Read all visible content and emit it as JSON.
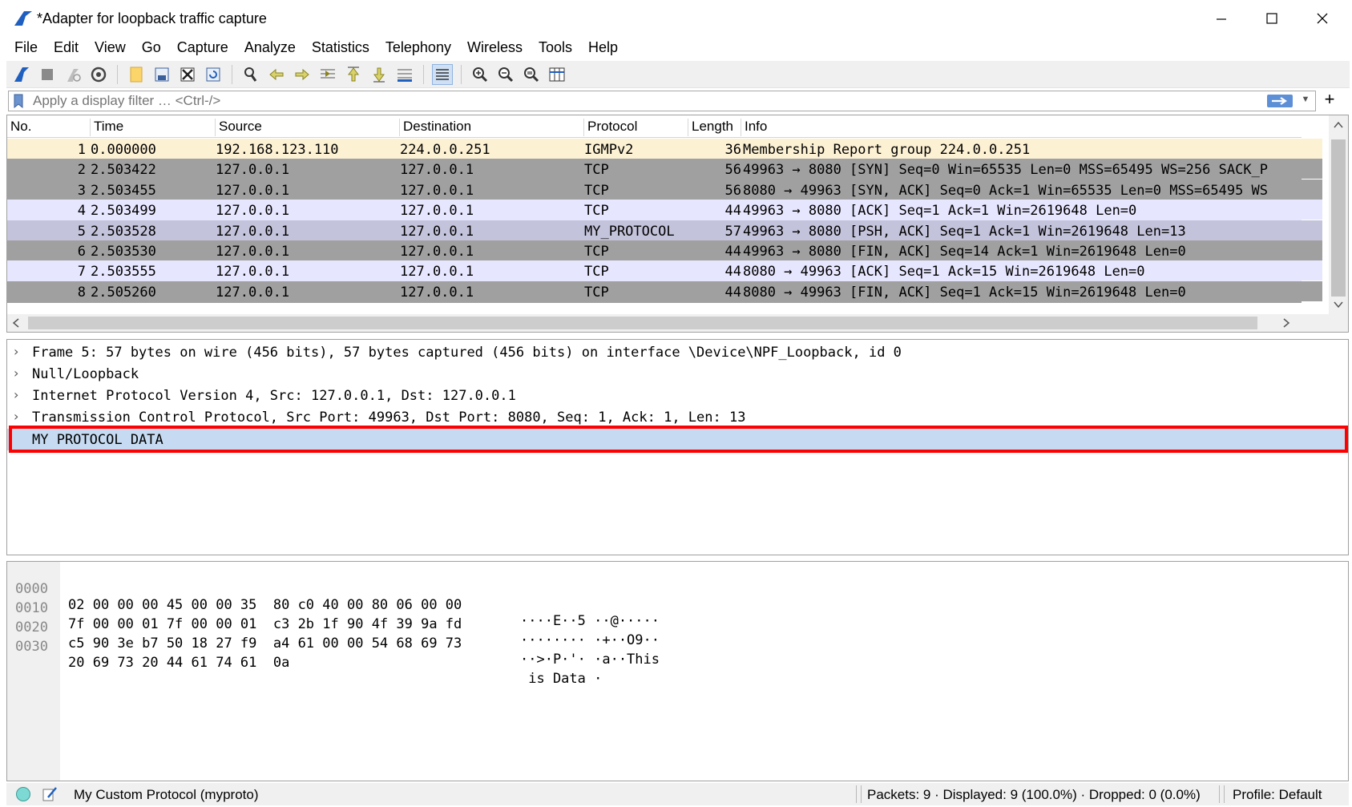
{
  "window": {
    "title": "*Adapter for loopback traffic capture"
  },
  "menu": [
    "File",
    "Edit",
    "View",
    "Go",
    "Capture",
    "Analyze",
    "Statistics",
    "Telephony",
    "Wireless",
    "Tools",
    "Help"
  ],
  "toolbar": {
    "icons": [
      "shark-fin-start-icon",
      "stop-icon",
      "restart-icon",
      "options-gear-icon",
      "open-file-icon",
      "save-file-icon",
      "close-file-icon",
      "reload-icon",
      "find-icon",
      "go-back-icon",
      "go-forward-icon",
      "go-to-packet-icon",
      "first-packet-icon",
      "last-packet-icon",
      "autoscroll-icon",
      "colorize-icon",
      "zoom-in-icon",
      "zoom-out-icon",
      "zoom-normal-icon",
      "resize-columns-icon"
    ]
  },
  "filter": {
    "placeholder": "Apply a display filter … <Ctrl-/>"
  },
  "packet_list": {
    "columns": [
      "No.",
      "Time",
      "Source",
      "Destination",
      "Protocol",
      "Length",
      "Info"
    ],
    "rows": [
      {
        "no": "1",
        "time": "0.000000",
        "src": "192.168.123.110",
        "dst": "224.0.0.251",
        "proto": "IGMPv2",
        "len": "36",
        "info": "Membership Report group 224.0.0.251",
        "bg": "#fdf1d4"
      },
      {
        "no": "2",
        "time": "2.503422",
        "src": "127.0.0.1",
        "dst": "127.0.0.1",
        "proto": "TCP",
        "len": "56",
        "info": "49963 → 8080 [SYN] Seq=0 Win=65535 Len=0 MSS=65495 WS=256 SACK_P",
        "bg": "#a0a0a0"
      },
      {
        "no": "3",
        "time": "2.503455",
        "src": "127.0.0.1",
        "dst": "127.0.0.1",
        "proto": "TCP",
        "len": "56",
        "info": "8080 → 49963 [SYN, ACK] Seq=0 Ack=1 Win=65535 Len=0 MSS=65495 WS",
        "bg": "#a0a0a0"
      },
      {
        "no": "4",
        "time": "2.503499",
        "src": "127.0.0.1",
        "dst": "127.0.0.1",
        "proto": "TCP",
        "len": "44",
        "info": "49963 → 8080 [ACK] Seq=1 Ack=1 Win=2619648 Len=0",
        "bg": "#e7e6ff"
      },
      {
        "no": "5",
        "time": "2.503528",
        "src": "127.0.0.1",
        "dst": "127.0.0.1",
        "proto": "MY_PROTOCOL",
        "len": "57",
        "info": "49963 → 8080 [PSH, ACK] Seq=1 Ack=1 Win=2619648 Len=13",
        "bg": "#c4c3dc"
      },
      {
        "no": "6",
        "time": "2.503530",
        "src": "127.0.0.1",
        "dst": "127.0.0.1",
        "proto": "TCP",
        "len": "44",
        "info": "49963 → 8080 [FIN, ACK] Seq=14 Ack=1 Win=2619648 Len=0",
        "bg": "#a0a0a0"
      },
      {
        "no": "7",
        "time": "2.503555",
        "src": "127.0.0.1",
        "dst": "127.0.0.1",
        "proto": "TCP",
        "len": "44",
        "info": "8080 → 49963 [ACK] Seq=1 Ack=15 Win=2619648 Len=0",
        "bg": "#e7e6ff"
      },
      {
        "no": "8",
        "time": "2.505260",
        "src": "127.0.0.1",
        "dst": "127.0.0.1",
        "proto": "TCP",
        "len": "44",
        "info": "8080 → 49963 [FIN, ACK] Seq=1 Ack=15 Win=2619648 Len=0",
        "bg": "#a0a0a0"
      }
    ]
  },
  "details": {
    "rows": [
      {
        "text": "Frame 5: 57 bytes on wire (456 bits), 57 bytes captured (456 bits) on interface \\Device\\NPF_Loopback, id 0",
        "expandable": true
      },
      {
        "text": "Null/Loopback",
        "expandable": true
      },
      {
        "text": "Internet Protocol Version 4, Src: 127.0.0.1, Dst: 127.0.0.1",
        "expandable": true
      },
      {
        "text": "Transmission Control Protocol, Src Port: 49963, Dst Port: 8080, Seq: 1, Ack: 1, Len: 13",
        "expandable": true
      },
      {
        "text": "MY PROTOCOL DATA",
        "expandable": false,
        "selected": true
      }
    ]
  },
  "bytes": {
    "rows": [
      {
        "offset": "0000",
        "hex": "02 00 00 00 45 00 00 35  80 c0 40 00 80 06 00 00",
        "ascii": "····E··5 ··@·····"
      },
      {
        "offset": "0010",
        "hex": "7f 00 00 01 7f 00 00 01  c3 2b 1f 90 4f 39 9a fd",
        "ascii": "········ ·+··O9··"
      },
      {
        "offset": "0020",
        "hex": "c5 90 3e b7 50 18 27 f9  a4 61 00 00 54 68 69 73",
        "ascii": "··>·P·'· ·a··This"
      },
      {
        "offset": "0030",
        "hex": "20 69 73 20 44 61 74 61  0a",
        "ascii": " is Data ·"
      }
    ]
  },
  "status": {
    "protocol_text": "My Custom Protocol (myproto)",
    "packets_text": "Packets: 9 · Displayed: 9 (100.0%) · Dropped: 0 (0.0%)",
    "profile_text": "Profile: Default"
  }
}
